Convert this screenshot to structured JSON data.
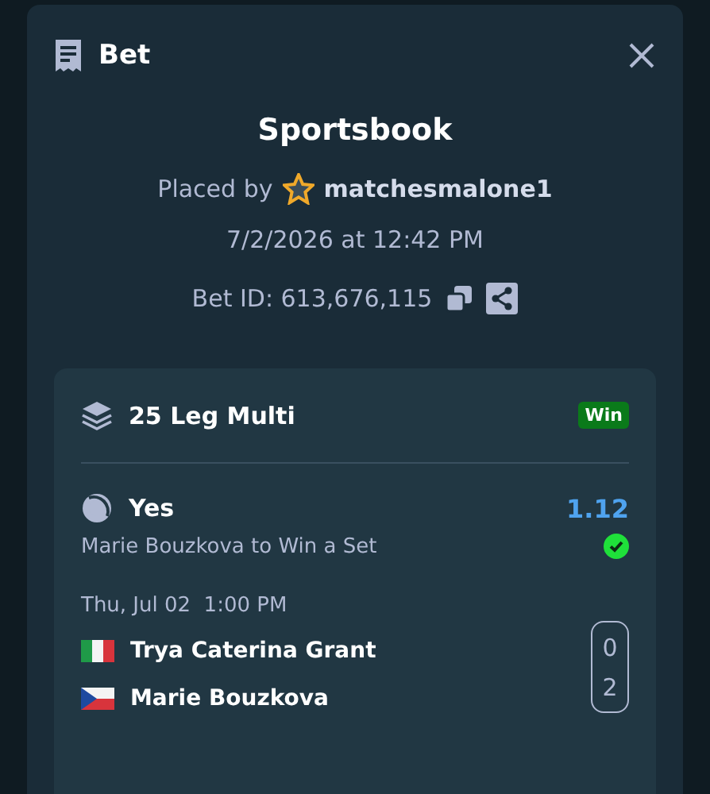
{
  "header": {
    "title": "Bet"
  },
  "summary": {
    "book": "Sportsbook",
    "placed_by_label": "Placed by",
    "user": "matchesmalone1",
    "datetime": "7/2/2026 at 12:42 PM",
    "bet_id": "Bet ID: 613,676,115"
  },
  "bet": {
    "title": "25 Leg Multi",
    "status": "Win",
    "legs": [
      {
        "selection": "Yes",
        "odds": "1.12",
        "market": "Marie Bouzkova to Win a Set",
        "won": true,
        "start": "Thu, Jul 02  1:00 PM",
        "players": [
          {
            "name": "Trya Caterina Grant",
            "kind": "italy",
            "score": "0"
          },
          {
            "name": "Marie Bouzkova",
            "kind": "czechia",
            "score": "2"
          }
        ]
      }
    ]
  }
}
